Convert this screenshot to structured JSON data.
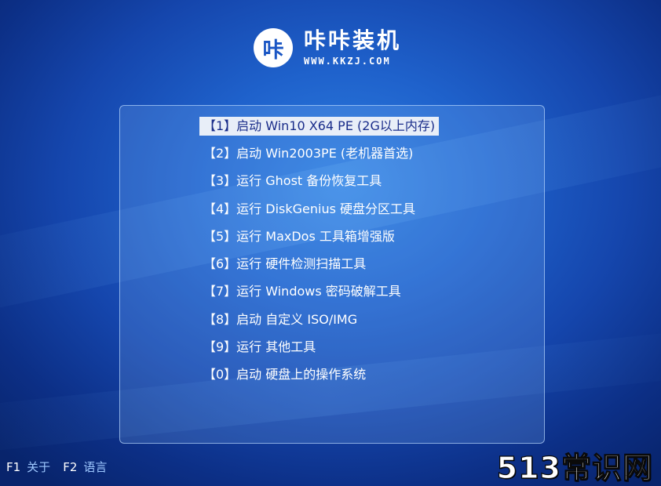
{
  "logo": {
    "icon_glyph": "咔",
    "title": "咔咔装机",
    "url": "WWW.KKZJ.COM"
  },
  "menu": {
    "selected_index": 0,
    "items": [
      {
        "label": "【1】启动 Win10 X64 PE (2G以上内存)"
      },
      {
        "label": "【2】启动 Win2003PE (老机器首选)"
      },
      {
        "label": "【3】运行 Ghost 备份恢复工具"
      },
      {
        "label": "【4】运行 DiskGenius 硬盘分区工具"
      },
      {
        "label": "【5】运行 MaxDos 工具箱增强版"
      },
      {
        "label": "【6】运行 硬件检测扫描工具"
      },
      {
        "label": "【7】运行 Windows 密码破解工具"
      },
      {
        "label": "【8】启动 自定义 ISO/IMG"
      },
      {
        "label": "【9】运行 其他工具"
      },
      {
        "label": "【0】启动 硬盘上的操作系统"
      }
    ]
  },
  "footer": {
    "f1_key": "F1",
    "f1_label": "关于",
    "f2_key": "F2",
    "f2_label": "语言"
  },
  "watermark": "513常识网",
  "colors": {
    "background_center": "#2e7fe0",
    "background_edge": "#08246c",
    "selected_bg": "#e8eef8",
    "selected_text": "#1a2d8a",
    "footer_desc": "#9ec8ff"
  }
}
